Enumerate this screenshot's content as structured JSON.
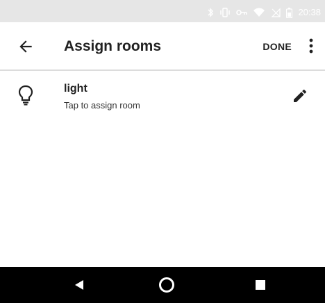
{
  "status_bar": {
    "time": "20:38",
    "icons": [
      "bluetooth-icon",
      "vibrate-icon",
      "vpn-key-icon",
      "wifi-icon",
      "no-sim-icon",
      "battery-icon"
    ]
  },
  "app_bar": {
    "back_icon": "arrow-left-icon",
    "title": "Assign rooms",
    "done_label": "DONE",
    "overflow_icon": "more-vert-icon"
  },
  "devices": [
    {
      "icon": "lightbulb-icon",
      "name": "light",
      "subtitle": "Tap to assign room",
      "action_icon": "pencil-icon"
    }
  ],
  "nav_bar": {
    "back_icon": "triangle-back-icon",
    "home_icon": "circle-home-icon",
    "recents_icon": "square-recents-icon"
  },
  "colors": {
    "status_bar_bg": "#e6e6e6",
    "nav_bar_bg": "#000000",
    "text_primary": "#212121",
    "divider": "#dcdcdc"
  }
}
